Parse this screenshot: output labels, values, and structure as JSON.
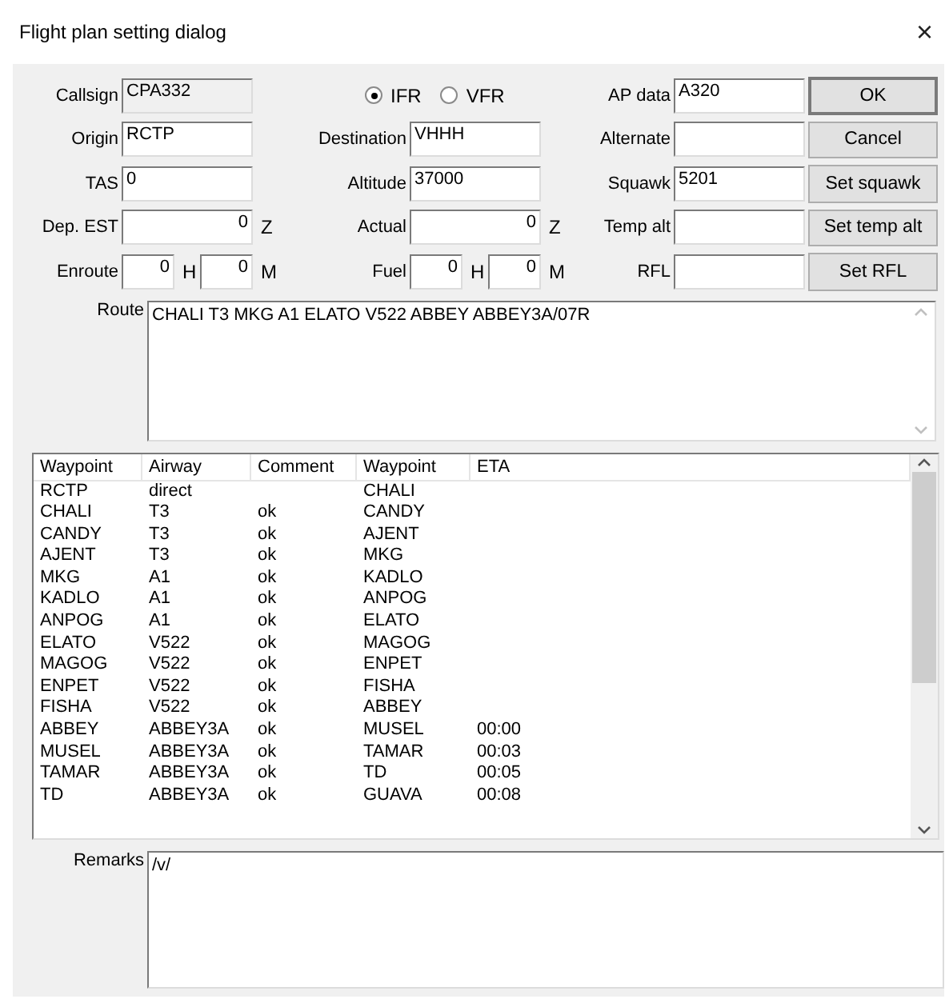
{
  "window": {
    "title": "Flight plan setting dialog",
    "close": "×"
  },
  "form_rows": [
    {
      "left": {
        "kind": "field",
        "label": "Callsign",
        "value": "CPA332",
        "readonly": true
      },
      "middle": {
        "kind": "radios",
        "options": [
          {
            "label": "IFR",
            "selected": true
          },
          {
            "label": "VFR",
            "selected": false
          }
        ]
      },
      "right": {
        "kind": "field",
        "label": "AP data",
        "value": "A320"
      }
    },
    {
      "left": {
        "kind": "field",
        "label": "Origin",
        "value": "RCTP"
      },
      "middle": {
        "kind": "field",
        "label": "Destination",
        "value": "VHHH"
      },
      "right": {
        "kind": "field",
        "label": "Alternate"
      }
    },
    {
      "left": {
        "kind": "field",
        "label": "TAS",
        "value": "0"
      },
      "middle": {
        "kind": "field",
        "label": "Altitude",
        "value": "37000"
      },
      "right": {
        "kind": "field",
        "label": "Squawk",
        "value": "5201"
      }
    },
    {
      "left": {
        "kind": "field",
        "label": "Dep. EST",
        "value": "0",
        "unit": "Z"
      },
      "middle": {
        "kind": "field",
        "label": "Actual",
        "value": "0",
        "unit": "Z"
      },
      "right": {
        "kind": "field",
        "label": "Temp alt"
      }
    },
    {
      "left": {
        "kind": "split",
        "label": "Enroute",
        "hours": "0",
        "hours_unit": "H",
        "minutes": "0",
        "minutes_unit": "M"
      },
      "middle": {
        "kind": "split",
        "label": "Fuel",
        "hours": "0",
        "hours_unit": "H",
        "minutes": "0",
        "minutes_unit": "M"
      },
      "right": {
        "kind": "field",
        "label": "RFL"
      }
    }
  ],
  "buttons": [
    "OK",
    "Cancel",
    "Set squawk",
    "Set temp alt",
    "Set RFL"
  ],
  "route": {
    "label": "Route",
    "value": "CHALI T3 MKG A1 ELATO V522 ABBEY ABBEY3A/07R"
  },
  "table": {
    "columns": [
      "Waypoint",
      "Airway",
      "Comment",
      "Waypoint",
      "ETA"
    ],
    "rows": [
      {
        "waypoint": "RCTP",
        "airway": "direct",
        "next_waypoint": "CHALI"
      },
      {
        "waypoint": "CHALI",
        "airway": "T3",
        "comment": "ok",
        "next_waypoint": "CANDY"
      },
      {
        "waypoint": "CANDY",
        "airway": "T3",
        "comment": "ok",
        "next_waypoint": "AJENT"
      },
      {
        "waypoint": "AJENT",
        "airway": "T3",
        "comment": "ok",
        "next_waypoint": "MKG"
      },
      {
        "waypoint": "MKG",
        "airway": "A1",
        "comment": "ok",
        "next_waypoint": "KADLO"
      },
      {
        "waypoint": "KADLO",
        "airway": "A1",
        "comment": "ok",
        "next_waypoint": "ANPOG"
      },
      {
        "waypoint": "ANPOG",
        "airway": "A1",
        "comment": "ok",
        "next_waypoint": "ELATO"
      },
      {
        "waypoint": "ELATO",
        "airway": "V522",
        "comment": "ok",
        "next_waypoint": "MAGOG"
      },
      {
        "waypoint": "MAGOG",
        "airway": "V522",
        "comment": "ok",
        "next_waypoint": "ENPET"
      },
      {
        "waypoint": "ENPET",
        "airway": "V522",
        "comment": "ok",
        "next_waypoint": "FISHA"
      },
      {
        "waypoint": "FISHA",
        "airway": "V522",
        "comment": "ok",
        "next_waypoint": "ABBEY"
      },
      {
        "waypoint": "ABBEY",
        "airway": "ABBEY3A",
        "comment": "ok",
        "next_waypoint": "MUSEL",
        "eta": "00:00"
      },
      {
        "waypoint": "MUSEL",
        "airway": "ABBEY3A",
        "comment": "ok",
        "next_waypoint": "TAMAR",
        "eta": "00:03"
      },
      {
        "waypoint": "TAMAR",
        "airway": "ABBEY3A",
        "comment": "ok",
        "next_waypoint": "TD",
        "eta": "00:05"
      },
      {
        "waypoint": "TD",
        "airway": "ABBEY3A",
        "comment": "ok",
        "next_waypoint": "GUAVA",
        "eta": "00:08"
      }
    ]
  },
  "remarks": {
    "label": "Remarks",
    "value": "/v/"
  }
}
